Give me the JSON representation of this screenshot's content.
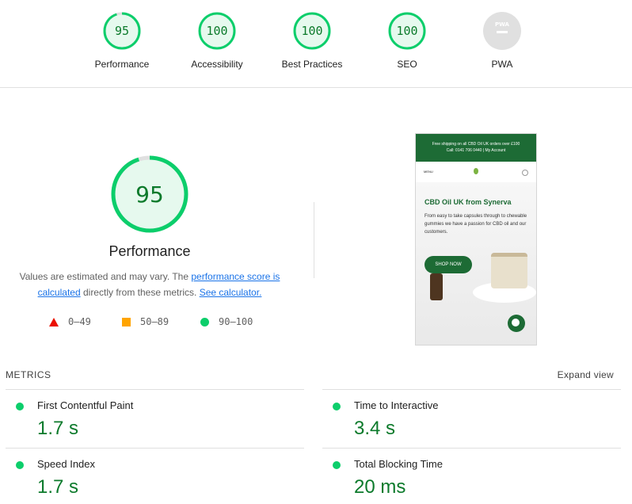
{
  "categories": [
    {
      "label": "Performance",
      "score": 95,
      "display": "95"
    },
    {
      "label": "Accessibility",
      "score": 100,
      "display": "100"
    },
    {
      "label": "Best Practices",
      "score": 100,
      "display": "100"
    },
    {
      "label": "SEO",
      "score": 100,
      "display": "100"
    },
    {
      "label": "PWA",
      "score": null,
      "display": "PWA"
    }
  ],
  "performance": {
    "score": 95,
    "score_text": "95",
    "title": "Performance",
    "desc_prefix": "Values are estimated and may vary. The ",
    "desc_link1": "performance score is calculated",
    "desc_mid": " directly from these metrics. ",
    "desc_link2": "See calculator."
  },
  "legend": [
    {
      "icon": "triangle-red",
      "range": "0–49"
    },
    {
      "icon": "square-orange",
      "range": "50–89"
    },
    {
      "icon": "circle-green",
      "range": "90–100"
    }
  ],
  "colors": {
    "pass": "#0cce6b",
    "pass_text": "#0c7a2b",
    "average": "#ffa400",
    "fail": "#eb0f00",
    "neutral": "#e0e0e0"
  },
  "screenshot": {
    "banner_line1": "Free shipping on all CBD Oil UK orders over £100",
    "banner_line2": "Call: 0141 706 0440   |   My Account",
    "menu": "MENU",
    "heading": "CBD Oil UK from Synerva",
    "text": "From easy to take capsules through to chewable gummies we have a passion for CBD oil and our customers.",
    "button": "SHOP NOW"
  },
  "metrics": {
    "header": "METRICS",
    "expand": "Expand view",
    "items": [
      {
        "name": "First Contentful Paint",
        "value": "1.7 s"
      },
      {
        "name": "Time to Interactive",
        "value": "3.4 s"
      },
      {
        "name": "Speed Index",
        "value": "1.7 s"
      },
      {
        "name": "Total Blocking Time",
        "value": "20 ms"
      }
    ]
  }
}
